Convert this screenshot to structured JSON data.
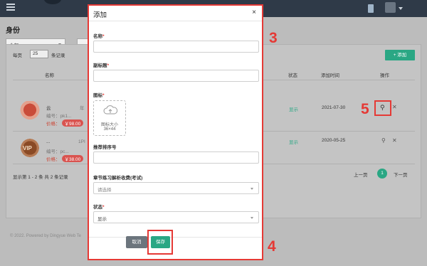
{
  "page": {
    "title": "身份",
    "filter_select": "全部",
    "per_page_prefix": "每页",
    "per_page_value": "25",
    "per_page_suffix": "条记录",
    "add_button": "+ 添加",
    "columns": [
      "名称",
      "状态",
      "添加时间",
      "操作"
    ],
    "rows": [
      {
        "line1": "云",
        "line1b": "年",
        "line2": "编号：pk1...",
        "price_label": "价格：",
        "price": "￥98.00",
        "status": "显示",
        "date": "2021-07-30"
      },
      {
        "line1": "...",
        "line1b": "1PI",
        "line2": "编号：pc...",
        "price_label": "价格：",
        "price": "￥38.00",
        "status": "显示",
        "date": "2020-05-25"
      }
    ],
    "vip_badge": "VIP",
    "footer_info": "显示第 1 - 2 条    共 2 条记录",
    "pager_prev": "上一页",
    "pager_current": "1",
    "pager_next": "下一页",
    "copyright": "© 2022. Powered by Dingyue Web Te"
  },
  "modal": {
    "title": "添加",
    "close": "×",
    "fields": {
      "name_label": "名称",
      "subtitle_label": "副标题",
      "icon_label": "图标",
      "icon_hint_line1": "图标大小",
      "icon_hint_line2": "36×44",
      "sort_label": "推荐排序号",
      "chapter_label": "章节练习解析收费(考试)",
      "chapter_placeholder": "请选择",
      "status_label": "状态",
      "status_value": "显示"
    },
    "required_mark": "*",
    "cancel_button": "取消",
    "save_button": "保存"
  },
  "annotations": {
    "n3": "3",
    "n4": "4",
    "n5": "5"
  },
  "colors": {
    "accent": "#2aa784",
    "annotation": "#e53935",
    "topbar": "#2f3a48"
  }
}
